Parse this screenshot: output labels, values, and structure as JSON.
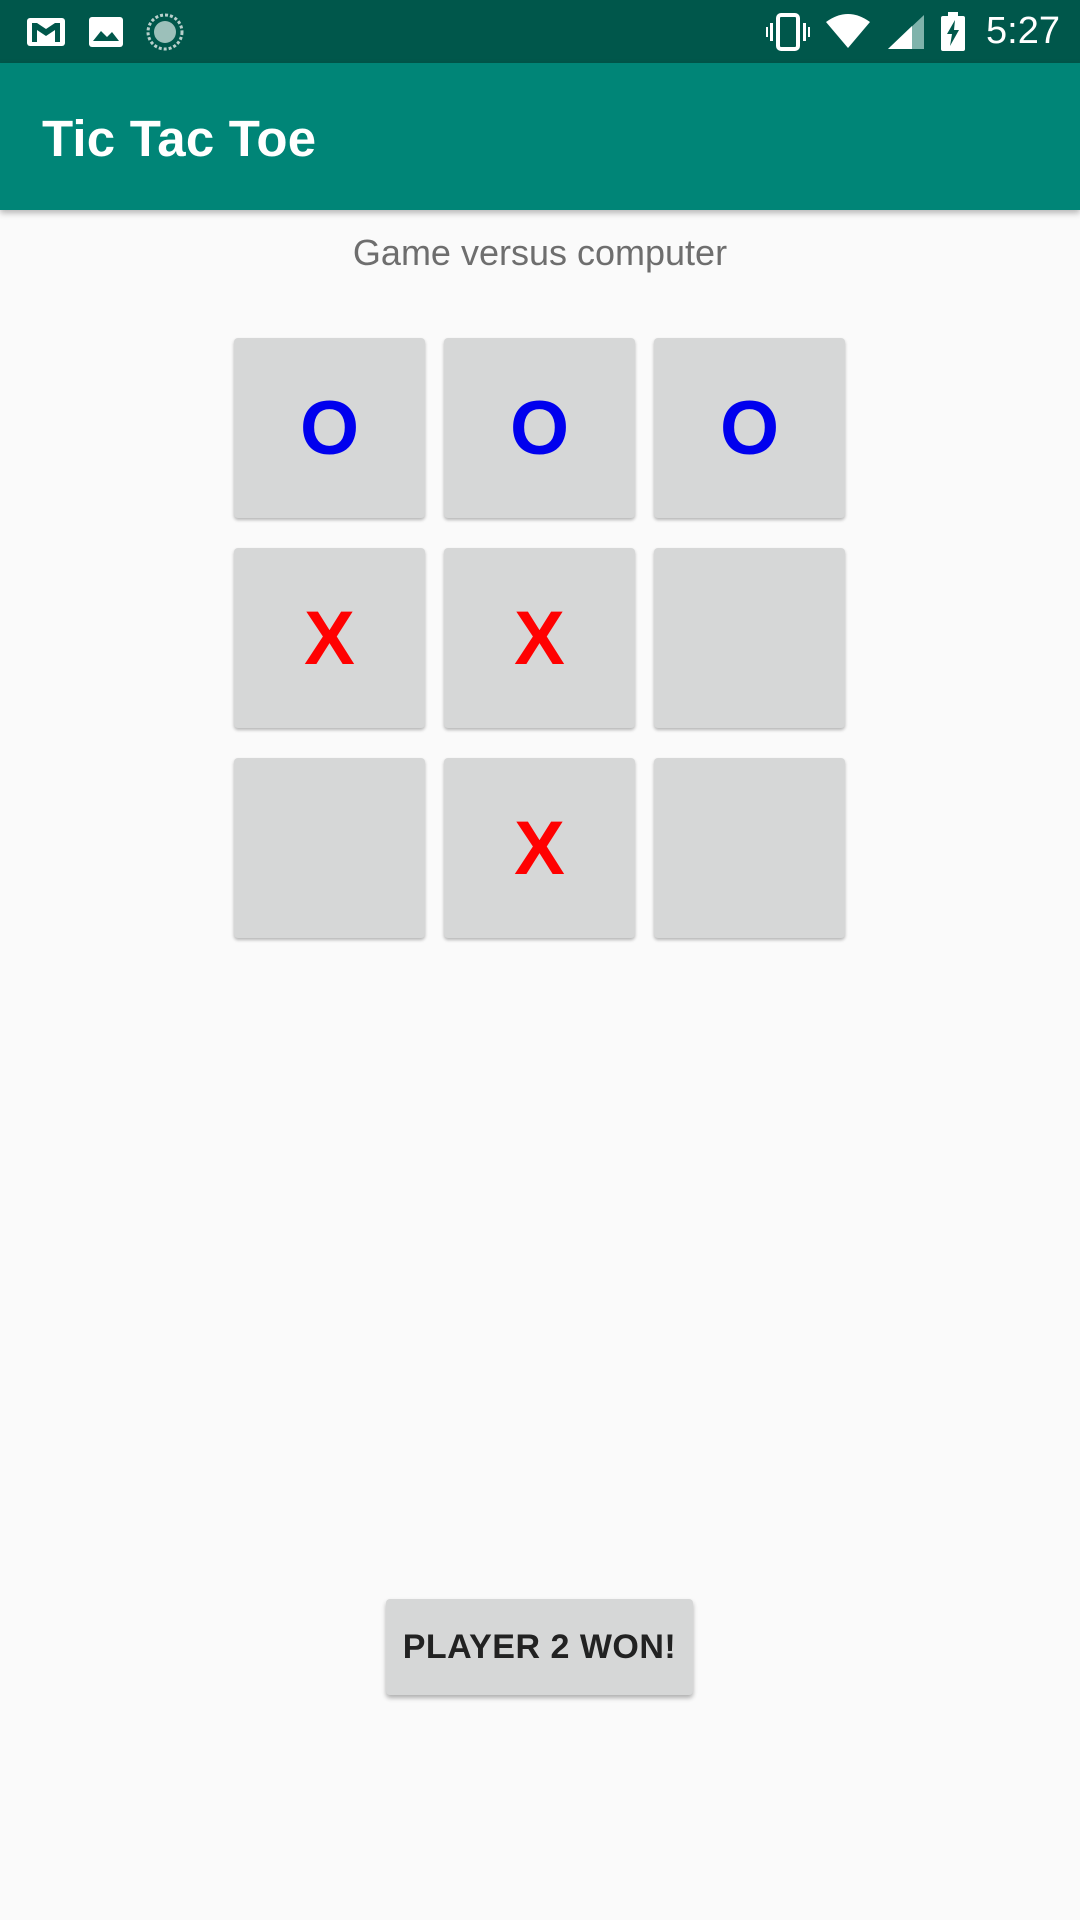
{
  "status_bar": {
    "time": "5:27",
    "left_icons": [
      "gmail-icon",
      "image-icon",
      "sync-icon"
    ],
    "right_icons": [
      "vibrate-icon",
      "wifi-icon",
      "signal-icon",
      "battery-charging-icon"
    ],
    "background": "#00574b"
  },
  "app_bar": {
    "title": "Tic Tac Toe",
    "background": "#008577"
  },
  "game": {
    "mode_label": "Game versus computer",
    "board": [
      [
        "O",
        "O",
        "O"
      ],
      [
        "X",
        "X",
        ""
      ],
      [
        "",
        "X",
        ""
      ]
    ],
    "colors": {
      "O": "#0000ee",
      "X": "#ff0000",
      "cell": "#d6d7d7"
    },
    "result_label": "PLAYER 2 WON!"
  }
}
